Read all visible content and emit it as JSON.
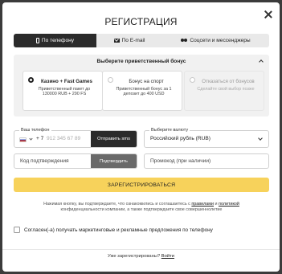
{
  "dialog": {
    "title": "РЕГИСТРАЦИЯ",
    "close_icon": "close-icon"
  },
  "tabs": [
    {
      "label": "По телефону",
      "icon": "phone-icon",
      "active": true
    },
    {
      "label": "По E-mail",
      "icon": "mail-icon",
      "active": false
    },
    {
      "label": "Соцсети и мессенджеры",
      "icon": "people-icon",
      "active": false
    }
  ],
  "bonus": {
    "heading": "Выберите приветственный бонус",
    "options": [
      {
        "title": "Казино + Fast Games",
        "description": "Приветственный пакет до 130000 RUB + 290 FS",
        "selected": true
      },
      {
        "title": "Бонус на спорт",
        "description": "Приветственный бонус за 1 депозит до 400 USD",
        "selected": false
      },
      {
        "title": "Отказаться от бонусов",
        "description": "Сделайте свой выбор позже",
        "selected": false
      }
    ]
  },
  "phone": {
    "label": "Ваш телефон",
    "country_code": "+ 7",
    "placeholder": "912 345 67 89",
    "send_label": "Отправить sms"
  },
  "currency": {
    "label": "Выберите валюту",
    "value": "Российский рубль (RUB)"
  },
  "confirm": {
    "placeholder": "Код подтверждения",
    "button_label": "Подтвердить"
  },
  "promo": {
    "placeholder": "Промокод (при наличии)"
  },
  "register_label": "ЗАРЕГИСТРИРОВАТЬСЯ",
  "legal": {
    "text_before": "Нажимая кнопку, вы подтверждаете, что ознакомились и соглашаетесь с ",
    "rules_link": "правилами",
    "and": " и ",
    "policy_link": "политикой",
    "text_after": " конфиденциальности компании, а также подтверждаете свое совершеннолетие"
  },
  "consent_label": "Согласен(-а) получать маркетинговые и рекламные предложения по телефону",
  "footer": {
    "question": "Уже зарегистрированы? ",
    "login_link": "Войти"
  }
}
